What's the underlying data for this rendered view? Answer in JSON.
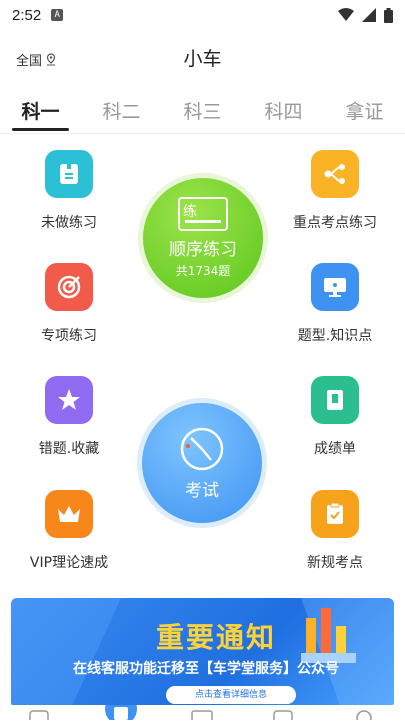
{
  "status": {
    "time": "2:52",
    "a_badge": "A"
  },
  "header": {
    "region": "全国",
    "title": "小车"
  },
  "tabs": [
    {
      "label": "科一",
      "active": true
    },
    {
      "label": "科二",
      "active": false
    },
    {
      "label": "科三",
      "active": false
    },
    {
      "label": "科四",
      "active": false
    },
    {
      "label": "拿证",
      "active": false
    }
  ],
  "grid": {
    "unpracticed": "未做练习",
    "key_points": "重点考点练习",
    "special": "专项练习",
    "question_types": "题型.知识点",
    "mistakes": "错题.收藏",
    "score": "成绩单",
    "vip": "VIP理论速成",
    "new_rules": "新规考点"
  },
  "sequential": {
    "icon_text": "练",
    "title": "顺序练习",
    "count": "共1734题"
  },
  "exam": {
    "title": "考试"
  },
  "banner": {
    "title": "重要通知",
    "text": "在线客服功能迁移至【车学堂服务】公众号",
    "button": "点击查看详细信息"
  },
  "colors": {
    "green": "#5cc61d",
    "blue": "#3e93f2",
    "teal": "#2bc0d6",
    "orange": "#f7a21b",
    "red": "#f25a4a",
    "purple": "#8e6bf0"
  }
}
